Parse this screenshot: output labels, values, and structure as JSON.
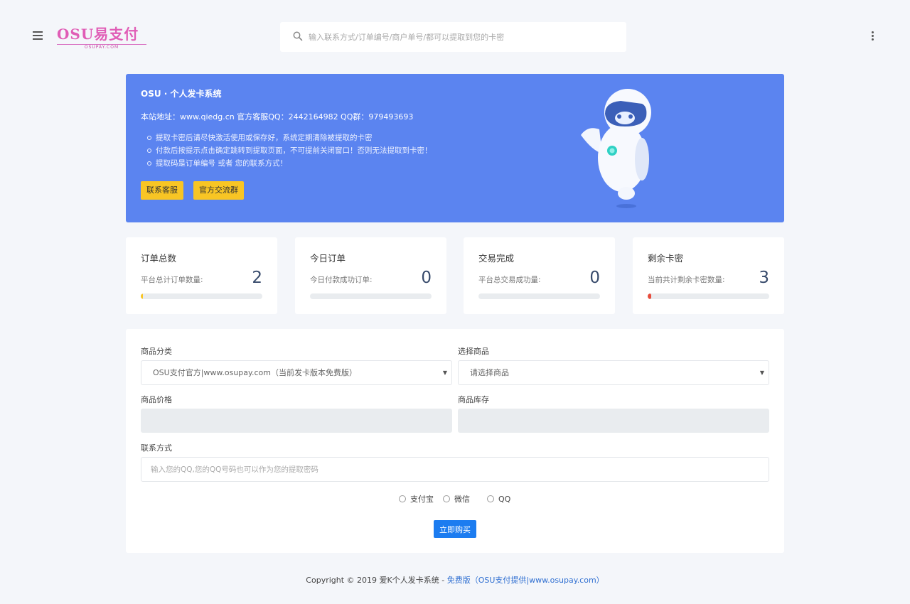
{
  "header": {
    "logo_main": "OSU易支付",
    "logo_sub": "OSUPAY.COM",
    "search_placeholder": "输入联系方式/订单编号/商户单号/都可以提取到您的卡密"
  },
  "banner": {
    "title": "OSU · 个人发卡系统",
    "info": "本站地址：www.qiedg.cn   官方客服QQ：2442164982   QQ群：979493693",
    "notes": [
      "提取卡密后请尽快激活使用或保存好，系统定期清除被提取的卡密",
      "付款后按提示点击确定跳转到提取页面，不可提前关闭窗口！否则无法提取到卡密！",
      "提取码是订单编号 或者 您的联系方式！"
    ],
    "btn_service": "联系客服",
    "btn_group": "官方交流群",
    "color": "#5b84f0"
  },
  "stats": [
    {
      "title": "订单总数",
      "label": "平台总计订单数量:",
      "value": "2",
      "progress": 0.02,
      "color": "#f8c524"
    },
    {
      "title": "今日订单",
      "label": "今日付款成功订单:",
      "value": "0",
      "progress": 0,
      "color": "#1c7cf0"
    },
    {
      "title": "交易完成",
      "label": "平台总交易成功量:",
      "value": "0",
      "progress": 0,
      "color": "#1c7cf0"
    },
    {
      "title": "剩余卡密",
      "label": "当前共计剩余卡密数量:",
      "value": "3",
      "progress": 0.03,
      "color": "#e74c3c"
    }
  ],
  "form": {
    "category_label": "商品分类",
    "category_value": "OSU支付官方|www.osupay.com（当前发卡版本免费版）",
    "product_label": "选择商品",
    "product_value": "请选择商品",
    "price_label": "商品价格",
    "stock_label": "商品库存",
    "contact_label": "联系方式",
    "contact_placeholder": "输入您的QQ,您的QQ号码也可以作为您的提取密码",
    "pay_alipay": "支付宝",
    "pay_wechat": "微信",
    "pay_qq": "QQ",
    "buy_label": "立即购买"
  },
  "footer": {
    "copyright": "Copyright © 2019 爱K个人发卡系统  -  ",
    "link": "免费版（OSU支付提供|www.osupay.com）"
  }
}
